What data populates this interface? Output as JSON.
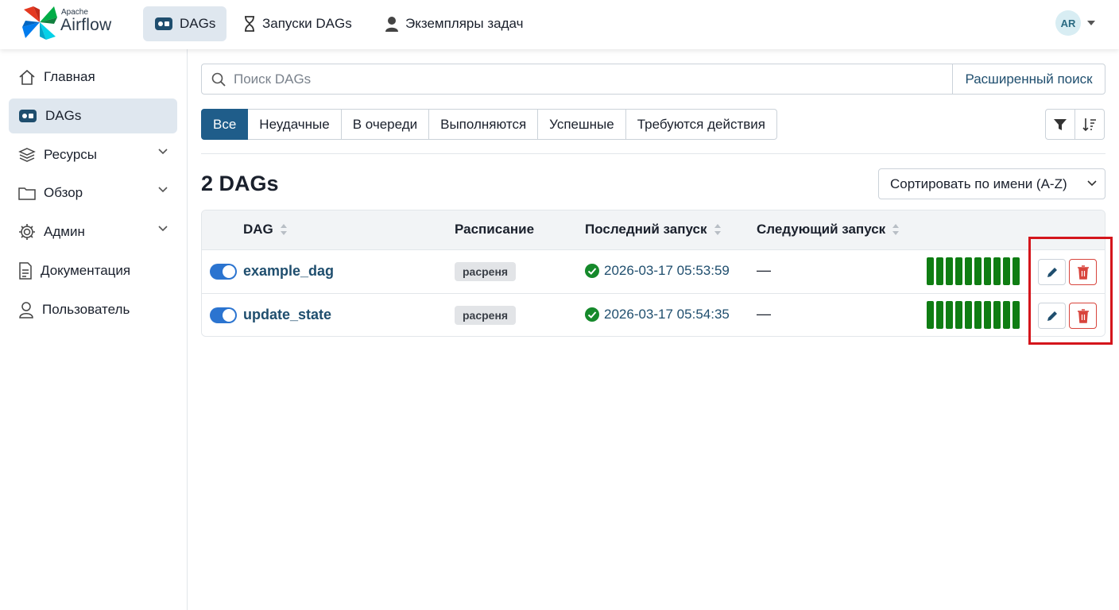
{
  "header": {
    "logo_small": "Apache",
    "logo_name": "Airflow",
    "nav": [
      {
        "label": "DAGs",
        "icon": "dag-icon",
        "active": true
      },
      {
        "label": "Запуски DAGs",
        "icon": "hourglass-icon"
      },
      {
        "label": "Экземпляры задач",
        "icon": "person-icon"
      }
    ],
    "user_initials": "AR"
  },
  "sidebar": {
    "items": [
      {
        "label": "Главная",
        "icon": "home-icon"
      },
      {
        "label": "DAGs",
        "icon": "dag-icon",
        "active": true
      },
      {
        "label": "Ресурсы",
        "icon": "layers-icon",
        "expandable": true
      },
      {
        "label": "Обзор",
        "icon": "folder-icon",
        "expandable": true
      },
      {
        "label": "Админ",
        "icon": "gear-icon",
        "expandable": true
      },
      {
        "label": "Документация",
        "icon": "document-icon"
      },
      {
        "label": "Пользователь",
        "icon": "user-icon"
      }
    ]
  },
  "search": {
    "placeholder": "Поиск DAGs",
    "value": "",
    "advanced_label": "Расширенный поиск"
  },
  "filters": {
    "items": [
      "Все",
      "Неудачные",
      "В очереди",
      "Выполняются",
      "Успешные",
      "Требуются действия"
    ],
    "active": "Все"
  },
  "list": {
    "count_title": "2 DAGs",
    "sort_label": "Сортировать по имени (A-Z)",
    "columns": {
      "dag": "DAG",
      "schedule": "Расписание",
      "last_run": "Последний запуск",
      "next_run": "Следующий запуск"
    },
    "rows": [
      {
        "name": "example_dag",
        "schedule": "расреня",
        "last_run": "2026-03-17 05:53:59",
        "next_run": "—",
        "enabled": true,
        "status": "success"
      },
      {
        "name": "update_state",
        "schedule": "расреня",
        "last_run": "2026-03-17 05:54:35",
        "next_run": "—",
        "enabled": true,
        "status": "success"
      }
    ]
  },
  "colors": {
    "accent": "#1f5d8a",
    "success_bar": "#0f7d13",
    "highlight": "#d4151c",
    "delete": "#d8443c"
  }
}
